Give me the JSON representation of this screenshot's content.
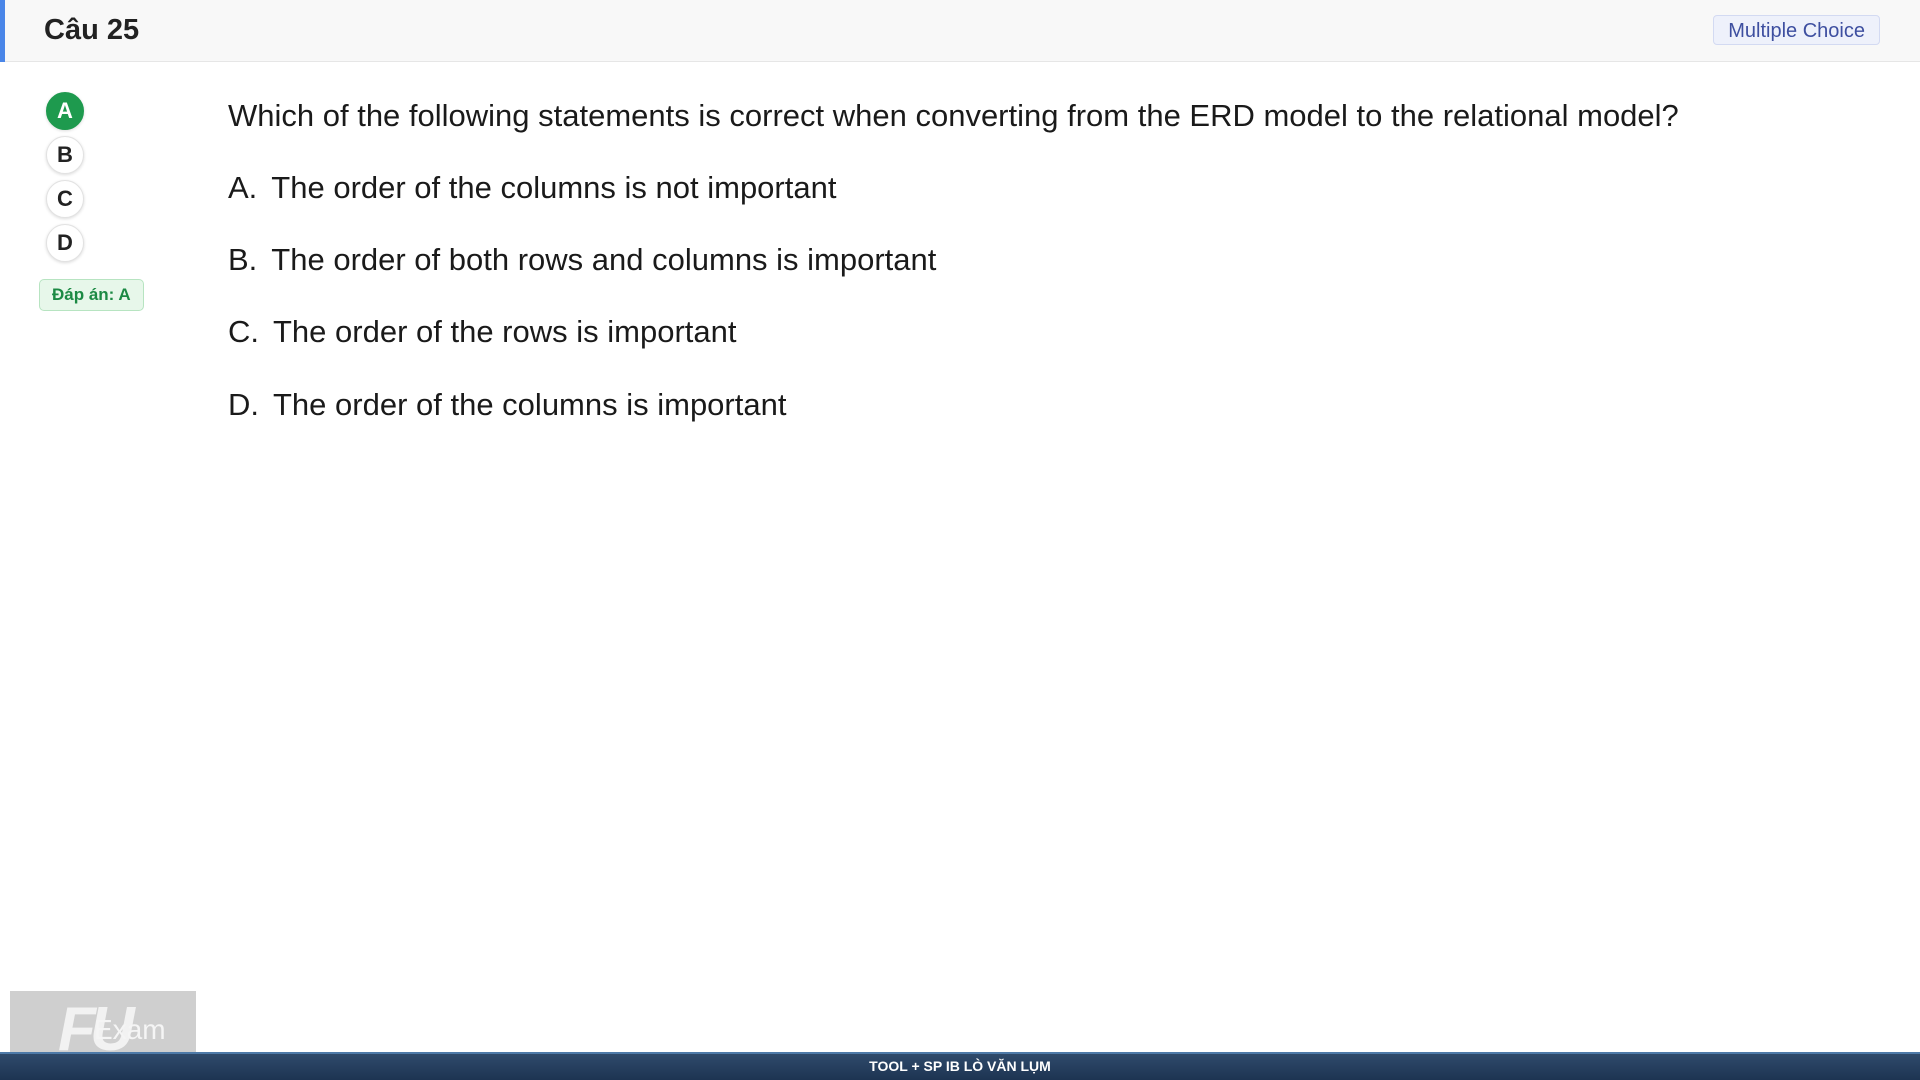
{
  "header": {
    "question_number": "Câu 25",
    "question_type": "Multiple Choice"
  },
  "options_panel": {
    "options": [
      "A",
      "B",
      "C",
      "D"
    ],
    "selected": "A",
    "answer_label": "Đáp án: A"
  },
  "question": {
    "text": "Which of the following statements is correct when converting from the ERD model to the relational model?",
    "choices": [
      {
        "letter": "A.",
        "text": "The order of the columns is not important"
      },
      {
        "letter": "B.",
        "text": "The order of both rows and columns is important"
      },
      {
        "letter": "C.",
        "text": "The order of the rows is important"
      },
      {
        "letter": "D.",
        "text": "The order of the columns is important"
      }
    ]
  },
  "logo": {
    "mark": "FU",
    "text": "Exam"
  },
  "footer": {
    "text": "TOOL + SP IB LÒ VĂN LỤM"
  },
  "colors": {
    "accent": "#4a86e8",
    "selected": "#1e9a4e",
    "answer_badge_text": "#1c8a44",
    "footer_bg": "#1d3452"
  }
}
